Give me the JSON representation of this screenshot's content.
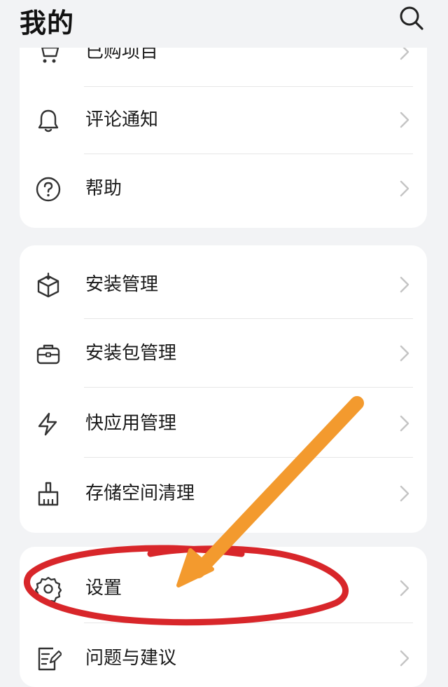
{
  "header": {
    "title": "我的"
  },
  "group1": {
    "items": [
      {
        "label": "已购项目",
        "icon": "cart-icon"
      },
      {
        "label": "评论通知",
        "icon": "bell-icon"
      },
      {
        "label": "帮助",
        "icon": "help-circle-icon"
      }
    ]
  },
  "group2": {
    "items": [
      {
        "label": "安装管理",
        "icon": "box-install-icon"
      },
      {
        "label": "安装包管理",
        "icon": "briefcase-icon"
      },
      {
        "label": "快应用管理",
        "icon": "lightning-icon"
      },
      {
        "label": "存储空间清理",
        "icon": "broom-icon"
      }
    ]
  },
  "group3": {
    "items": [
      {
        "label": "设置",
        "icon": "gear-icon"
      },
      {
        "label": "问题与建议",
        "icon": "feedback-edit-icon"
      }
    ]
  },
  "colors": {
    "background": "#f2f3f5",
    "card": "#ffffff",
    "text": "#1a1a1a",
    "chevron": "#c4c4c4",
    "annotation_circle": "#d8262a",
    "annotation_arrow": "#f39a2e"
  }
}
